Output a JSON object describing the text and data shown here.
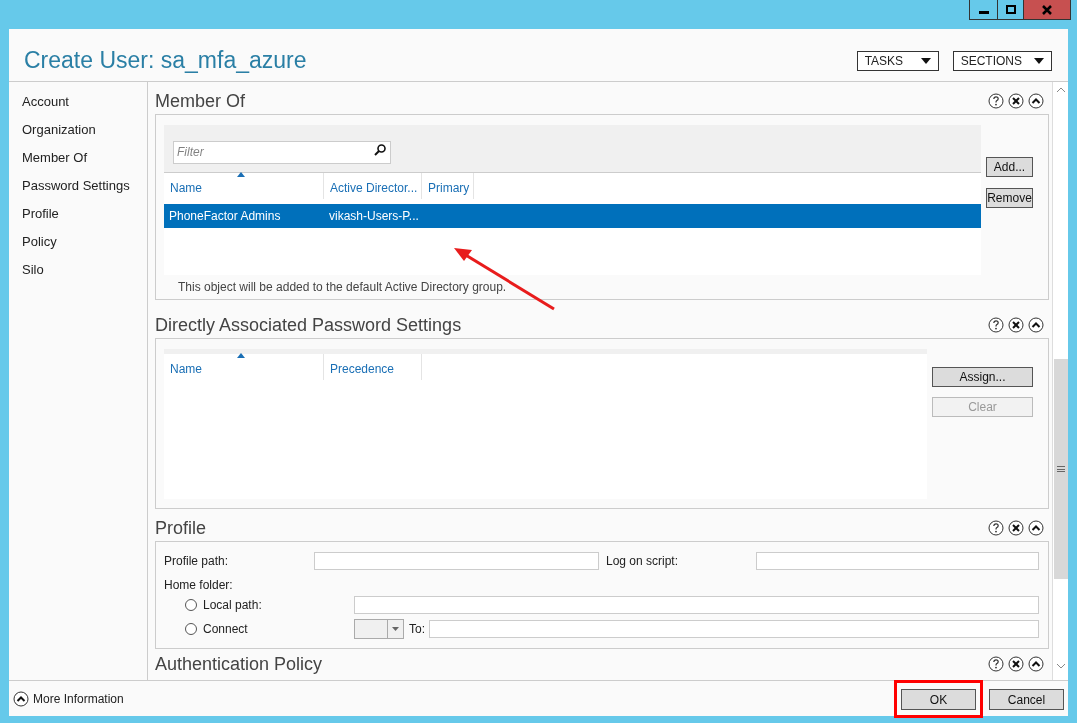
{
  "title": "Create User: sa_mfa_azure",
  "header_buttons": [
    {
      "label": "TASKS"
    },
    {
      "label": "SECTIONS"
    }
  ],
  "sidebar": {
    "items": [
      {
        "label": "Account"
      },
      {
        "label": "Organization"
      },
      {
        "label": "Member Of"
      },
      {
        "label": "Password Settings"
      },
      {
        "label": "Profile"
      },
      {
        "label": "Policy"
      },
      {
        "label": "Silo"
      }
    ]
  },
  "member_of": {
    "title": "Member Of",
    "filter": {
      "placeholder": "Filter"
    },
    "columns": [
      {
        "label": "Name",
        "sorted": true
      },
      {
        "label": "Active Director...",
        "sorted": false
      },
      {
        "label": "Primary",
        "sorted": false
      }
    ],
    "rows": [
      {
        "cells": [
          "PhoneFactor Admins",
          "vikash-Users-P..."
        ],
        "selected": true
      }
    ],
    "note": "This object will be added to the default Active Directory group.",
    "buttons": [
      {
        "label": "Add...",
        "disabled": false
      },
      {
        "label": "Remove",
        "disabled": false
      }
    ]
  },
  "password_settings": {
    "title": "Directly Associated Password Settings",
    "columns": [
      {
        "label": "Name",
        "sorted": true
      },
      {
        "label": "Precedence",
        "sorted": false
      }
    ],
    "buttons": [
      {
        "label": "Assign...",
        "disabled": false
      },
      {
        "label": "Clear",
        "disabled": true
      }
    ]
  },
  "profile": {
    "title": "Profile",
    "profile_path_label": "Profile path:",
    "logon_script_label": "Log on script:",
    "home_folder_label": "Home folder:",
    "options": [
      {
        "label": "Local path:",
        "checked": false
      },
      {
        "label": "Connect",
        "checked": false
      }
    ],
    "to_label": "To:"
  },
  "auth_policy": {
    "title": "Authentication Policy"
  },
  "footer": {
    "more_info": "More Information",
    "buttons": [
      {
        "label": "OK",
        "highlighted": true
      },
      {
        "label": "Cancel",
        "highlighted": false
      }
    ]
  }
}
